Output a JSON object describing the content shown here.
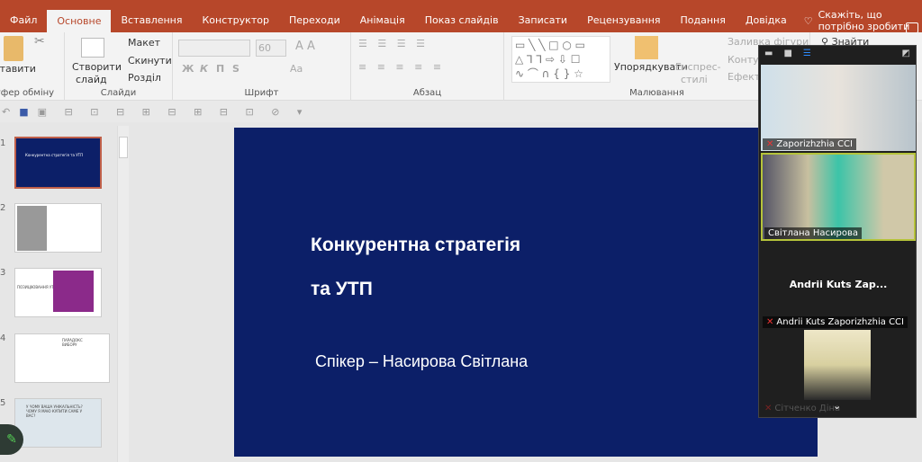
{
  "tabs": [
    "Файл",
    "Основне",
    "Вставлення",
    "Конструктор",
    "Переходи",
    "Анімація",
    "Показ слайдів",
    "Записати",
    "Рецензування",
    "Подання",
    "Довідка"
  ],
  "active_tab": "Основне",
  "tell_me": "Скажіть, що потрібно зробити",
  "ribbon": {
    "clipboard": {
      "paste": "Вставити",
      "label": "Буфер обміну"
    },
    "slides": {
      "new_slide": "Створити",
      "new_slide2": "слайд",
      "layout": "Макет",
      "reset": "Скинути",
      "section": "Розділ",
      "label": "Слайди"
    },
    "font": {
      "size": "60",
      "bold": "Ж",
      "italic": "К",
      "underline": "П",
      "shadow": "S",
      "case": "Aa",
      "label": "Шрифт"
    },
    "paragraph": {
      "label": "Абзац"
    },
    "drawing": {
      "arrange": "Упорядкувати",
      "quick_styles": "Експрес-",
      "quick_styles2": "стилі",
      "fill": "Заливка фігури",
      "outline": "Контур",
      "effects": "Ефекти",
      "label": "Малювання"
    },
    "editing": {
      "find": "Знайти"
    }
  },
  "thumbnails": [
    {
      "num": "1",
      "title": "Конкурентна стратегія та УТП"
    },
    {
      "num": "2",
      "title": ""
    },
    {
      "num": "3",
      "title": "ПОЗИЦІЮВАННЯ УТП"
    },
    {
      "num": "4",
      "title": "ПАРАДОКС ВИБОРУ"
    },
    {
      "num": "5",
      "title": "У ЧОМУ ВАША УНІКАЛЬНІСТЬ? ЧОМУ Я МАЮ КУПИТИ САМЕ У ВАС?"
    }
  ],
  "slide": {
    "title1": "Конкурентна стратегія",
    "title2": "та УТП",
    "speaker": "Спікер – Насирова Світлана",
    "bg": "#0c1f68"
  },
  "zoom": {
    "participants": [
      {
        "name": "Zaporizhzhia CCI",
        "muted": true
      },
      {
        "name": "Світлана Насирова",
        "muted": false,
        "active": true
      },
      {
        "name": "Andrii Kuts Zap...",
        "label": "Andrii Kuts Zaporizhzhia CCI",
        "muted": true,
        "video": false
      },
      {
        "name": "Сітченко Діна",
        "muted": true
      }
    ]
  },
  "colors": {
    "accent": "#b7472a",
    "active_speaker": "#b5c33a"
  }
}
